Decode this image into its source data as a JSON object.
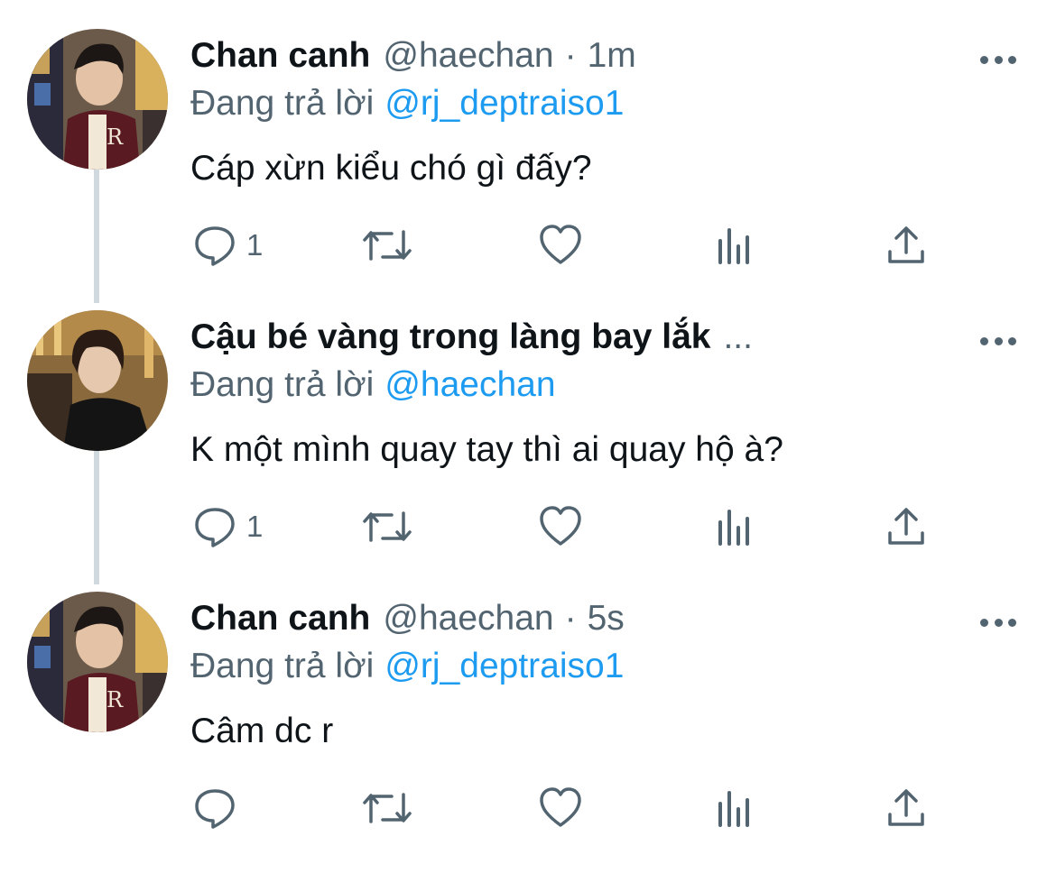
{
  "tweets": [
    {
      "name": "Chan canh",
      "handle": "@haechan",
      "separator": "·",
      "time": "1m",
      "replying_prefix": "Đang trả lời",
      "replying_to": "@rj_deptraiso1",
      "text": "Cáp xừn kiểu chó gì đấy?",
      "reply_count": "1"
    },
    {
      "name": "Cậu bé vàng trong làng bay lắk",
      "name_overflow": "...",
      "replying_prefix": "Đang trả lời",
      "replying_to": "@haechan",
      "text": "K một mình quay tay thì ai quay hộ à?",
      "reply_count": "1"
    },
    {
      "name": "Chan canh",
      "handle": "@haechan",
      "separator": "·",
      "time": "5s",
      "replying_prefix": "Đang trả lời",
      "replying_to": "@rj_deptraiso1",
      "text": "Câm dc r",
      "reply_count": ""
    }
  ],
  "icons": [
    "reply-icon",
    "retweet-icon",
    "like-icon",
    "analytics-icon",
    "share-icon",
    "more-icon"
  ],
  "colors": {
    "text": "#0f1419",
    "secondary": "#536471",
    "link": "#1d9bf0",
    "thread_line": "#cfd9de"
  }
}
